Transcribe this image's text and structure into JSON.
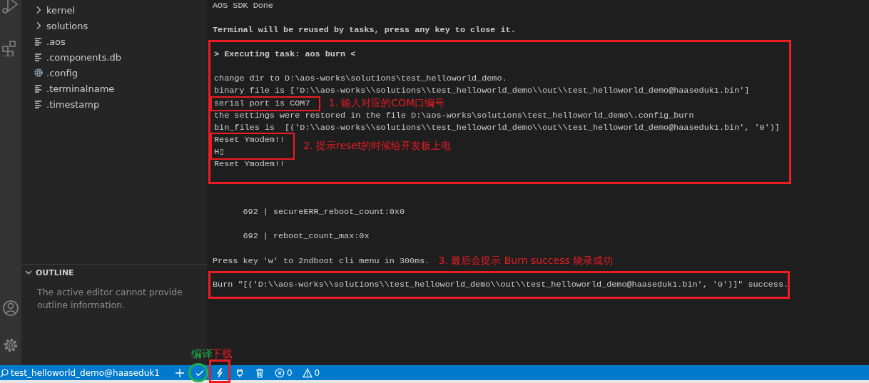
{
  "explorer": {
    "items": [
      {
        "name": "kernel",
        "kind": "folder",
        "expanded": false
      },
      {
        "name": "solutions",
        "kind": "folder",
        "expanded": false
      },
      {
        "name": ".aos",
        "kind": "file"
      },
      {
        "name": ".components.db",
        "kind": "file"
      },
      {
        "name": ".config",
        "kind": "settings"
      },
      {
        "name": ".terminalname",
        "kind": "file"
      },
      {
        "name": ".timestamp",
        "kind": "file"
      }
    ]
  },
  "outline": {
    "title": "OUTLINE",
    "expanded": true,
    "message": "The active editor cannot provide outline information."
  },
  "terminal": {
    "blocks": [
      {
        "framed": false,
        "lines": [
          {
            "kind": "line",
            "text": "AOS SDK Done",
            "bold": false
          }
        ]
      },
      {
        "framed": false,
        "lines": [
          {
            "kind": "line",
            "text": "Terminal will be reused by tasks, press any key to close it.",
            "bold": true
          }
        ]
      },
      {
        "framed": true,
        "header": {
          "text": "> Executing task: aos burn <",
          "bold": true
        },
        "lines": [
          {
            "kind": "line",
            "text": "change dir to D:\\aos-works\\solutions\\test_helloworld_demo.",
            "bold": false
          },
          {
            "kind": "line",
            "text": "binary file is ['D:\\\\aos-works\\\\solutions\\\\test_helloworld_demo\\\\out\\\\test_helloworld_demo@haaseduk1.bin']",
            "bold": false
          },
          {
            "kind": "group",
            "note": "1. 输入对应的COM口编号",
            "lines": [
              {
                "kind": "line",
                "text": "serial port is COM7",
                "bold": false
              }
            ]
          },
          {
            "kind": "line",
            "text": "the settings were restored in the file D:\\aos-works\\solutions\\test_helloworld_demo\\.config_burn",
            "bold": false
          },
          {
            "kind": "line",
            "text": "bin_files is  [('D:\\\\aos-works\\\\solutions\\\\test_helloworld_demo\\\\out\\\\test_helloworld_demo@haaseduk1.bin', '0')]",
            "bold": false
          },
          {
            "kind": "group",
            "note": "2. 提示reset的时候给开发板上电",
            "lines": [
              {
                "kind": "line",
                "text": "Reset Ymodem!!",
                "bold": false
              },
              {
                "kind": "line",
                "text": "H▯",
                "bold": false
              }
            ]
          },
          {
            "kind": "line",
            "text": "Reset Ymodem!!",
            "bold": false
          }
        ]
      },
      {
        "framed": false,
        "lines": [
          {
            "kind": "line",
            "text": "      692 | secureERR_reboot_count:0x0",
            "bold": false
          }
        ]
      },
      {
        "framed": false,
        "lines": [
          {
            "kind": "line",
            "text": "      692 | reboot_count_max:0x",
            "bold": false
          }
        ]
      },
      {
        "framed": false,
        "lines": [
          {
            "kind": "line",
            "text": "Press key 'w' to 2ndboot cli menu in 300ms.",
            "bold": false,
            "note": "3. 最后会提示 Burn success 烧录成功"
          }
        ]
      },
      {
        "framed": true,
        "lines": [
          {
            "kind": "line",
            "text": "Burn \"[('D:\\\\aos-works\\\\solutions\\\\test_helloworld_demo\\\\out\\\\test_helloworld_demo@haaseduk1.bin', '0')]\" success.",
            "bold": false
          }
        ]
      }
    ]
  },
  "status_bar": {
    "workspace": "test_helloworld_demo@haaseduk1",
    "items": [
      {
        "kind": "add"
      },
      {
        "kind": "build",
        "note": "编译",
        "color": "#22b14c"
      },
      {
        "kind": "flash",
        "note": "下载",
        "color": "#ed1c24"
      },
      {
        "kind": "plug"
      },
      {
        "kind": "trash"
      },
      {
        "kind": "errors",
        "count": "0"
      },
      {
        "kind": "warnings",
        "count": "0"
      }
    ]
  }
}
